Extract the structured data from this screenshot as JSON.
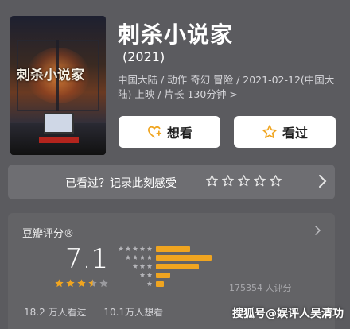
{
  "movie": {
    "poster_title": "刺杀小说家",
    "title": "刺杀小说家",
    "year": "(2021)",
    "meta": "中国大陆 / 动作 奇幻 冒险 / 2021-02-12(中国大陆) 上映 / 片长 130分钟 >"
  },
  "actions": {
    "want_label": "想看",
    "seen_label": "看过"
  },
  "rate_prompt": {
    "label": "已看过？记录此刻感受"
  },
  "rating": {
    "card_label": "豆瓣评分®",
    "score": "7.1",
    "stars": 3.5,
    "distribution": [
      {
        "stars": 5,
        "fraction": 0.22
      },
      {
        "stars": 4,
        "fraction": 0.36
      },
      {
        "stars": 3,
        "fraction": 0.28
      },
      {
        "stars": 2,
        "fraction": 0.09
      },
      {
        "stars": 1,
        "fraction": 0.05
      }
    ],
    "votes": "175354 人评分"
  },
  "footer": {
    "watched": "18.2 万人看过",
    "wants": "10.1万人想看"
  },
  "watermark": "搜狐号@娱评人吴清功",
  "colors": {
    "background": "#5b5b5f",
    "accent_star": "#f0a520",
    "button_bg": "#ffffff"
  }
}
